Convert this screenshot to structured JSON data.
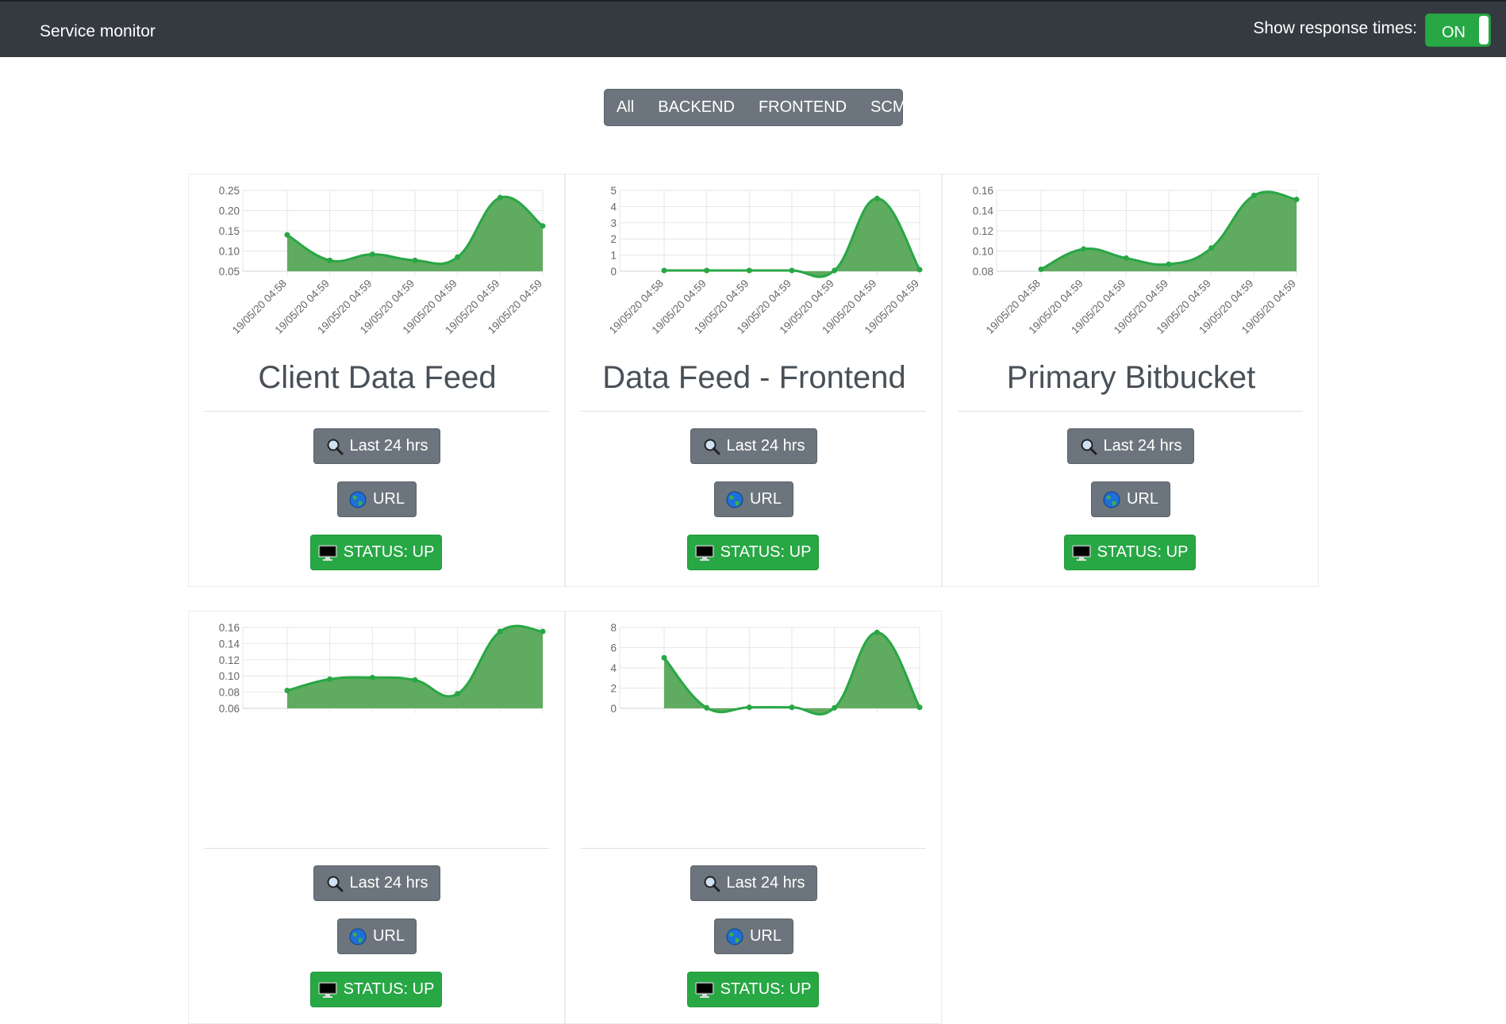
{
  "navbar": {
    "brand": "Service monitor",
    "toggle_label": "Show response times:",
    "toggle_state": "ON"
  },
  "filters": [
    "All",
    "BACKEND",
    "FRONTEND",
    "SCM"
  ],
  "buttons": {
    "last24": "Last 24 hrs",
    "url": "URL",
    "status": "STATUS: UP"
  },
  "colors": {
    "navbar": "#343a40",
    "accent_green": "#28a745",
    "fill_green": "#5fab5f",
    "button_grey": "#6c757d"
  },
  "cards": [
    {
      "title": "Client Data Feed"
    },
    {
      "title": "Data Feed - Frontend"
    },
    {
      "title": "Primary Bitbucket"
    },
    {
      "title": ""
    },
    {
      "title": ""
    }
  ],
  "chart_data": [
    {
      "type": "area",
      "x": [
        "19/05/20 04:58",
        "19/05/20 04:59",
        "19/05/20 04:59",
        "19/05/20 04:59",
        "19/05/20 04:59",
        "19/05/20 04:59",
        "19/05/20 04:59"
      ],
      "values": [
        0.14,
        0.077,
        0.092,
        0.077,
        0.085,
        0.232,
        0.162
      ],
      "yticks": [
        "0.25",
        "0.20",
        "0.15",
        "0.10",
        "0.05"
      ],
      "ylim": [
        0.05,
        0.25
      ],
      "grid": true
    },
    {
      "type": "area",
      "x": [
        "19/05/20 04:58",
        "19/05/20 04:59",
        "19/05/20 04:59",
        "19/05/20 04:59",
        "19/05/20 04:59",
        "19/05/20 04:59",
        "19/05/20 04:59"
      ],
      "values": [
        0.05,
        0.05,
        0.05,
        0.05,
        0.05,
        4.5,
        0.1
      ],
      "yticks": [
        "5",
        "4",
        "3",
        "2",
        "1",
        "0"
      ],
      "ylim": [
        0,
        5
      ],
      "grid": true
    },
    {
      "type": "area",
      "x": [
        "19/05/20 04:58",
        "19/05/20 04:59",
        "19/05/20 04:59",
        "19/05/20 04:59",
        "19/05/20 04:59",
        "19/05/20 04:59",
        "19/05/20 04:59"
      ],
      "values": [
        0.082,
        0.102,
        0.093,
        0.087,
        0.103,
        0.155,
        0.151
      ],
      "yticks": [
        "0.16",
        "0.14",
        "0.12",
        "0.10",
        "0.08"
      ],
      "ylim": [
        0.08,
        0.16
      ],
      "grid": true
    },
    {
      "type": "area",
      "x": [
        "",
        "",
        "",
        "",
        "",
        "",
        ""
      ],
      "values": [
        0.082,
        0.096,
        0.098,
        0.095,
        0.078,
        0.155,
        0.155
      ],
      "yticks": [
        "0.16",
        "0.14",
        "0.12",
        "0.10",
        "0.08",
        "0.06"
      ],
      "ylim": [
        0.06,
        0.16
      ],
      "grid": true
    },
    {
      "type": "area",
      "x": [
        "",
        "",
        "",
        "",
        "",
        "",
        ""
      ],
      "values": [
        5,
        0.05,
        0.1,
        0.1,
        0.05,
        7.5,
        0.1
      ],
      "yticks": [
        "8",
        "6",
        "4",
        "2",
        "0"
      ],
      "ylim": [
        0,
        8
      ],
      "grid": true
    }
  ]
}
